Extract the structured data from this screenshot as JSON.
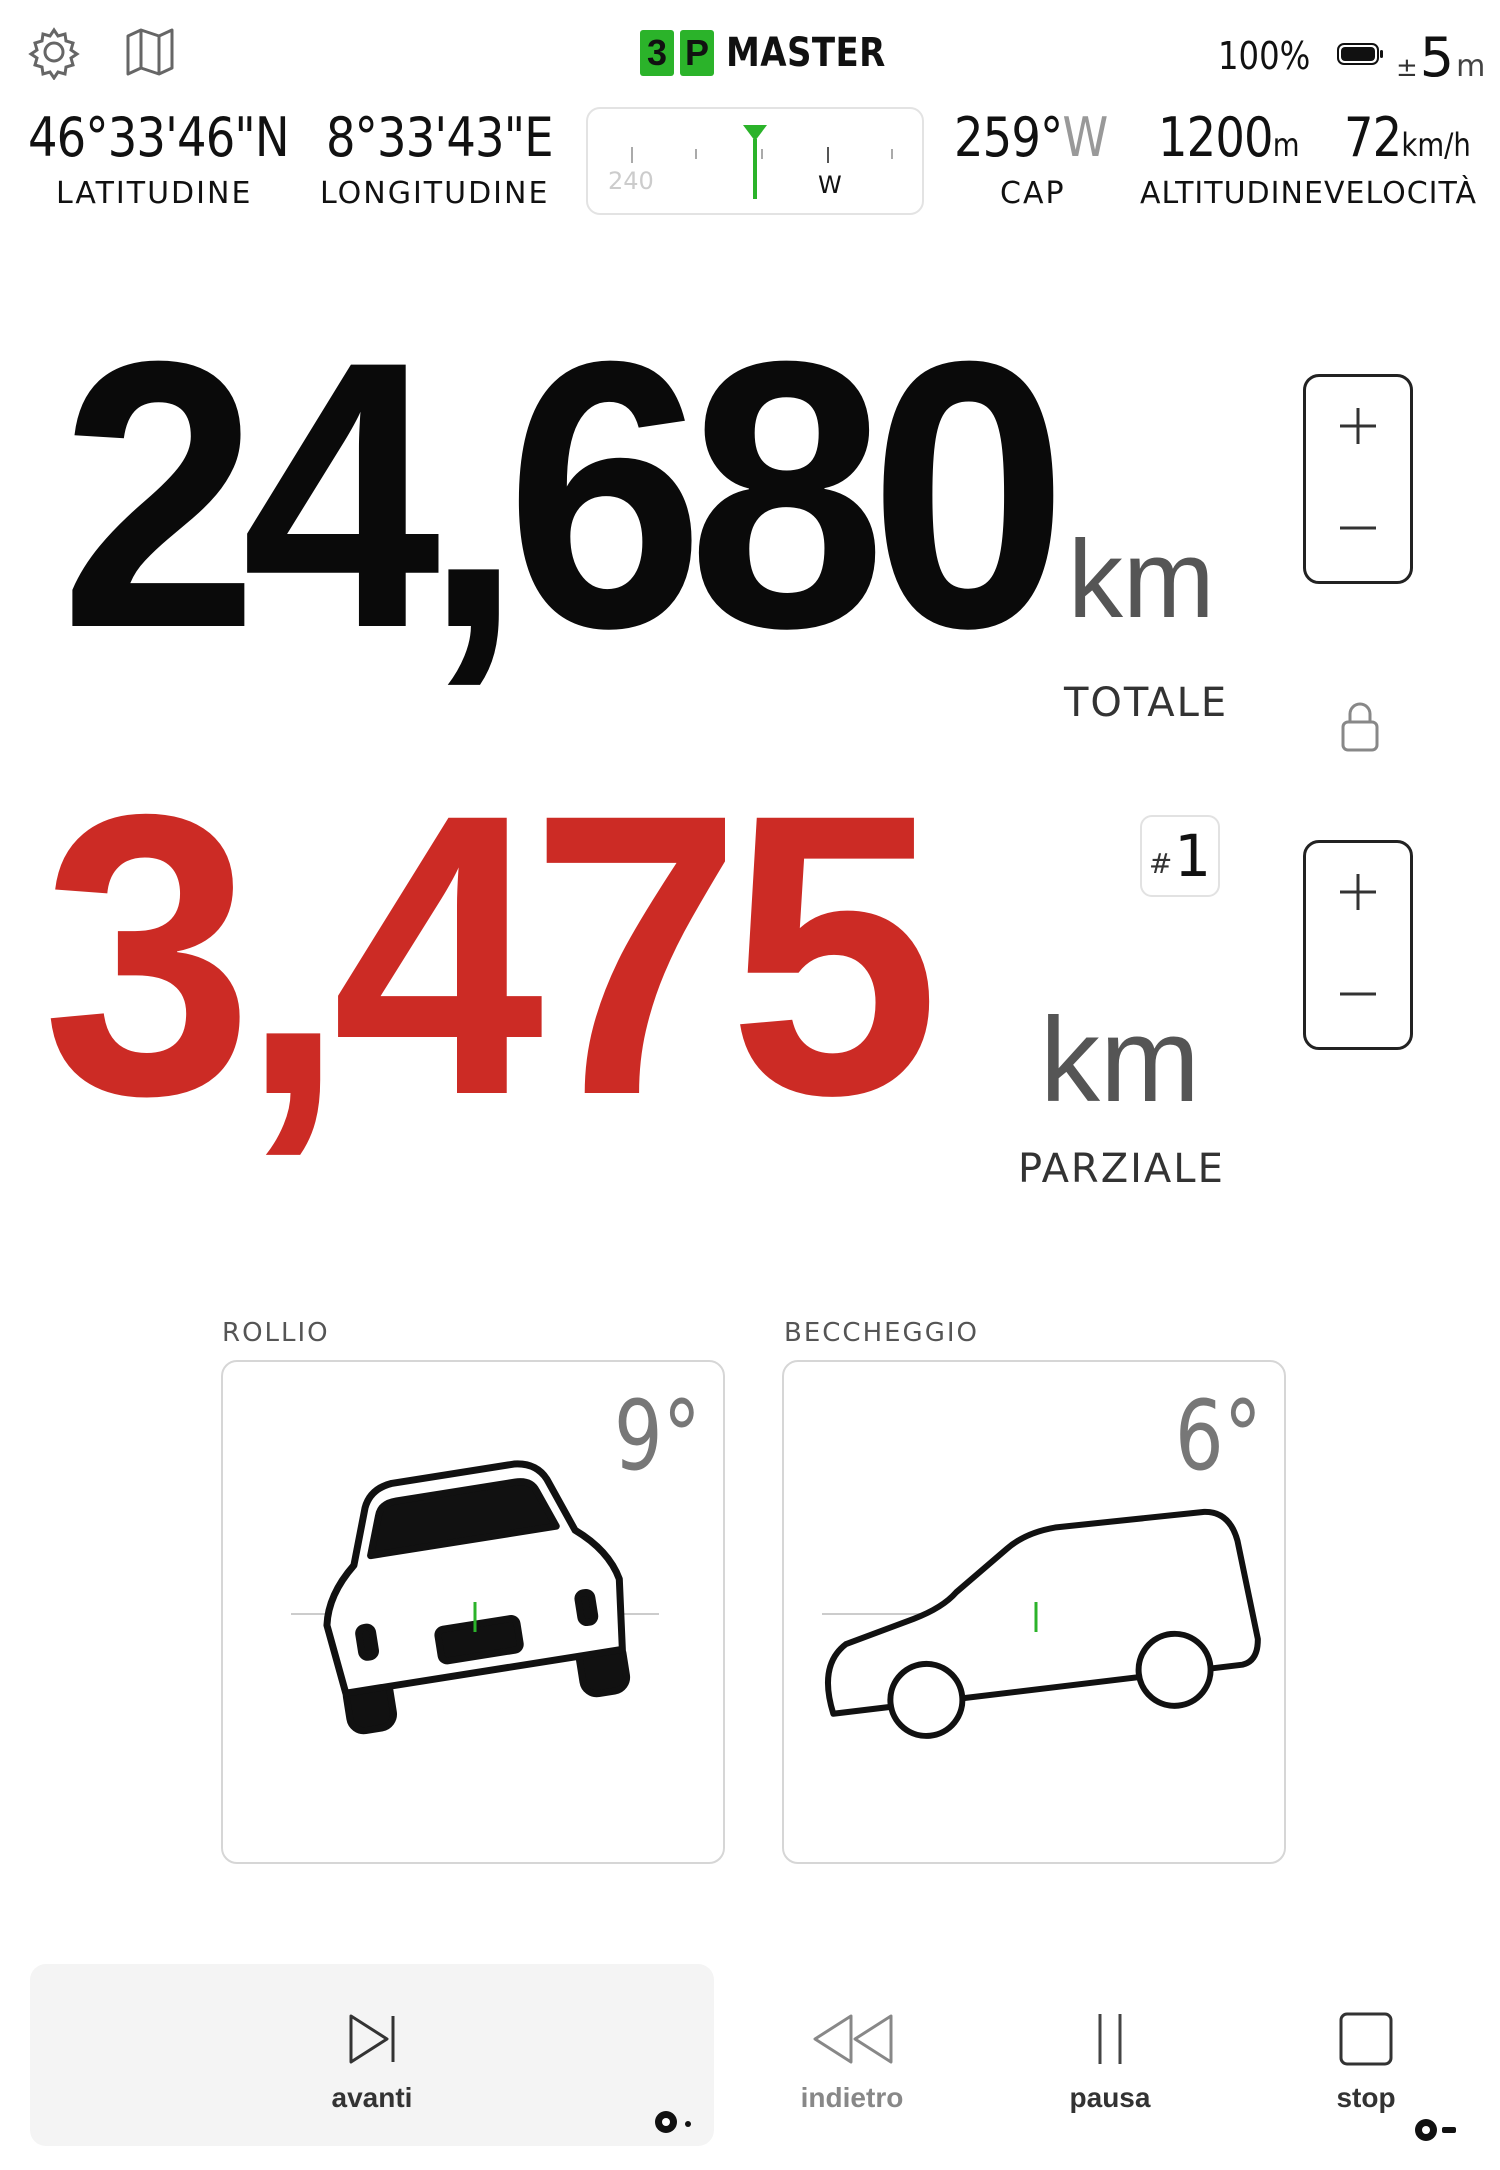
{
  "header": {
    "logo_box_1": "3",
    "logo_box_2": "P",
    "logo_word": "MASTER",
    "battery_pct": "100%",
    "gps_accuracy_prefix": "±",
    "gps_accuracy_value": "5",
    "gps_accuracy_unit": "m",
    "icons": [
      "gear-icon",
      "map-icon",
      "battery-icon"
    ]
  },
  "stats": {
    "latitude": {
      "value": "46°33'46\"N",
      "label": "LATITUDINE"
    },
    "longitude": {
      "value": "8°33'43\"E",
      "label": "LONGITUDINE"
    },
    "heading": {
      "value": "259°",
      "dir": "W",
      "label": "CAP"
    },
    "altitude": {
      "value": "1200",
      "unit": "m",
      "label": "ALTITUDINE"
    },
    "speed": {
      "value": "72",
      "unit": "km/h",
      "label": "VELOCITÀ"
    }
  },
  "compass": {
    "tick_label_left": "240",
    "tick_label_right": "W",
    "marker_color": "#2bb32a"
  },
  "total": {
    "value": "24,680",
    "unit": "km",
    "label": "TOTALE"
  },
  "partial": {
    "value": "3,475",
    "unit": "km",
    "label": "PARZIALE",
    "trip_hash": "#",
    "trip_number": "1"
  },
  "inclinometer": {
    "roll": {
      "label": "ROLLIO",
      "value": "9°"
    },
    "pitch": {
      "label": "BECCHEGGIO",
      "value": "6°"
    }
  },
  "controls": {
    "forward": "avanti",
    "back": "indietro",
    "pause": "pausa",
    "stop": "stop"
  },
  "colors": {
    "accent_green": "#2bb32a",
    "partial_red": "#cc2b25"
  }
}
